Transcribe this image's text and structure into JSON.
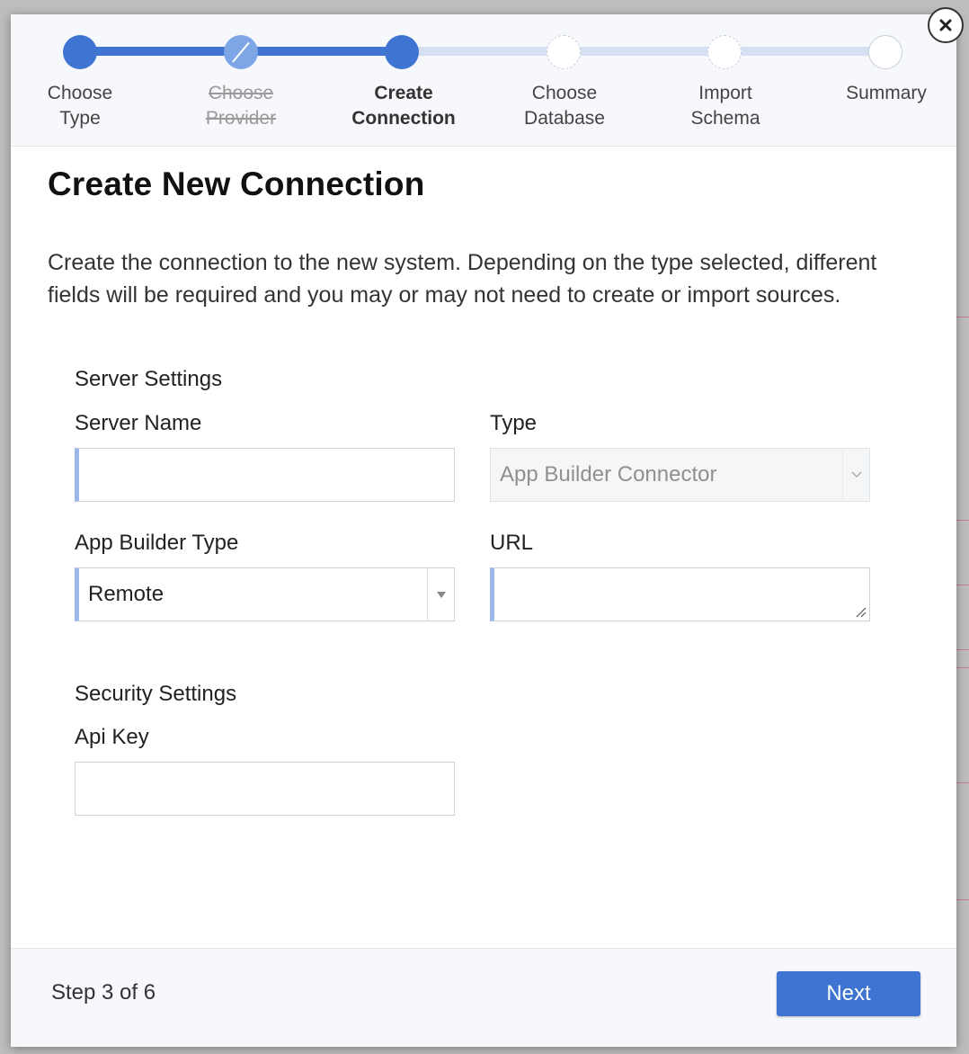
{
  "wizard": {
    "steps": [
      {
        "label_line1": "Choose",
        "label_line2": "Type",
        "state": "done"
      },
      {
        "label_line1": "Choose",
        "label_line2": "Provider",
        "state": "skipped"
      },
      {
        "label_line1": "Create",
        "label_line2": "Connection",
        "state": "current"
      },
      {
        "label_line1": "Choose",
        "label_line2": "Database",
        "state": "pending"
      },
      {
        "label_line1": "Import",
        "label_line2": "Schema",
        "state": "pending"
      },
      {
        "label_line1": "Summary",
        "label_line2": "",
        "state": "pending"
      }
    ]
  },
  "page": {
    "title": "Create New Connection",
    "description": "Create the connection to the new system. Depending on the type selected, different fields will be required and you may or may not need to create or import sources."
  },
  "server_settings": {
    "section_title": "Server Settings",
    "server_name": {
      "label": "Server Name",
      "value": ""
    },
    "type": {
      "label": "Type",
      "value": "App Builder Connector"
    },
    "app_builder_type": {
      "label": "App Builder Type",
      "value": "Remote"
    },
    "url": {
      "label": "URL",
      "value": ""
    }
  },
  "security_settings": {
    "section_title": "Security Settings",
    "api_key": {
      "label": "Api Key",
      "value": ""
    }
  },
  "footer": {
    "step_text": "Step 3 of 6",
    "next_label": "Next"
  },
  "colors": {
    "primary": "#3f74d3",
    "skipped": "#7ea6e6",
    "track_pending": "#d5e0f3",
    "input_accent": "#9cb9ea"
  }
}
